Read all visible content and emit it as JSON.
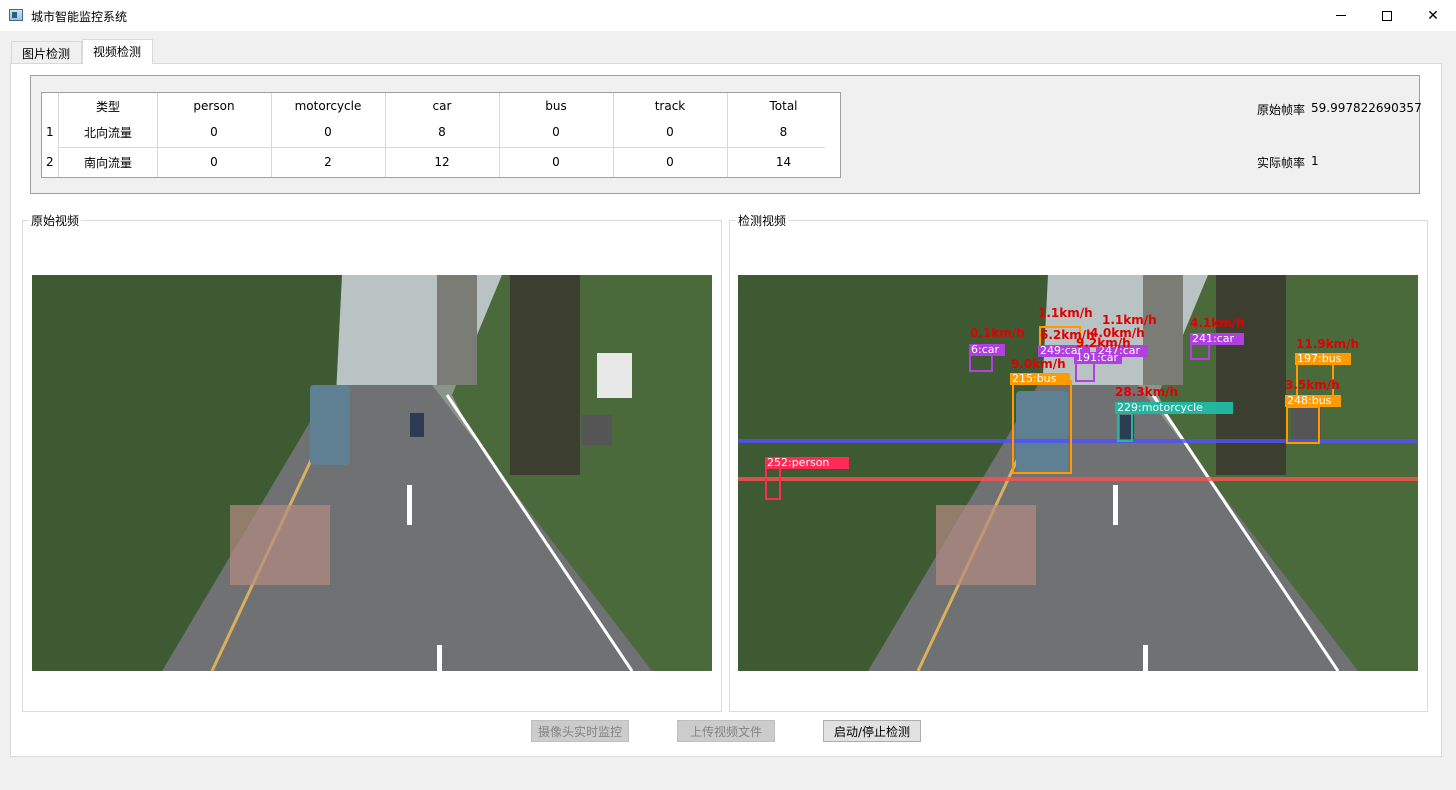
{
  "window": {
    "title": "城市智能监控系统"
  },
  "tabs": [
    {
      "label": "图片检测",
      "active": false
    },
    {
      "label": "视频检测",
      "active": true
    }
  ],
  "flow_table": {
    "headers": [
      "类型",
      "person",
      "motorcycle",
      "car",
      "bus",
      "track",
      "Total"
    ],
    "rows": [
      {
        "num": "1",
        "cells": [
          "北向流量",
          "0",
          "0",
          "8",
          "0",
          "0",
          "8"
        ]
      },
      {
        "num": "2",
        "cells": [
          "南向流量",
          "0",
          "2",
          "12",
          "0",
          "0",
          "14"
        ]
      }
    ]
  },
  "fps": {
    "original_label": "原始帧率",
    "original_value": "59.997822690357",
    "actual_label": "实际帧率",
    "actual_value": "1"
  },
  "groups": {
    "original_title": "原始视频",
    "detected_title": "检测视频"
  },
  "buttons": {
    "camera": "摄像头实时监控",
    "upload": "上传视频文件",
    "toggle": "启动/停止检测"
  },
  "detections": {
    "labels": [
      "6:car",
      "249:car",
      "247:car",
      "191:car",
      "241:car",
      "197:bus",
      "215:bus",
      "229:motorcycle",
      "248:bus",
      "252:person"
    ],
    "speeds": [
      "0.1km/h",
      "1.1km/h",
      "6.2km/h",
      "4.0km/h",
      "1.1km/h",
      "9.2km/h",
      "4.1km/h",
      "9.0km/h",
      "28.3km/h",
      "11.9km/h",
      "3.5km/h"
    ]
  },
  "colors": {
    "car": "#b040e0",
    "bus": "#ff9a00",
    "motorcycle": "#22b5a0",
    "person": "#ff2a55",
    "line_north": "#5050ff",
    "line_south": "#ff5050",
    "speed_text": "#e00000"
  }
}
